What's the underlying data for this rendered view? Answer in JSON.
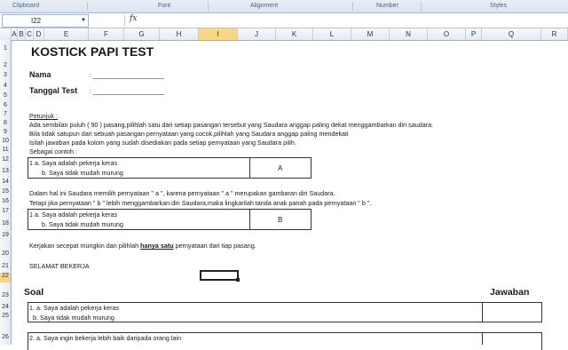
{
  "ribbon": {
    "groups": [
      "Clipboard",
      "Font",
      "Alignment",
      "Number",
      "Styles"
    ]
  },
  "formula_bar": {
    "name_box": "I22",
    "fx_label": "fx",
    "formula": ""
  },
  "columns": [
    "A",
    "B",
    "C",
    "D",
    "E",
    "F",
    "G",
    "H",
    "I",
    "J",
    "K",
    "L",
    "M",
    "N",
    "O",
    "P",
    "Q",
    "R"
  ],
  "selected_column": "I",
  "rows": [
    "1",
    "2",
    "3",
    "4",
    "5",
    "6",
    "7",
    "8",
    "9",
    "10",
    "11",
    "12",
    "13",
    "14",
    "15",
    "16",
    "17",
    "18",
    "19",
    "20",
    "21",
    "22",
    "23",
    "24",
    "25",
    "26"
  ],
  "selected_row": "22",
  "sheet": {
    "title": "KOSTICK PAPI TEST",
    "nama_label": "Nama",
    "nama_field": ": ____________________",
    "tanggal_label": "Tanggal Test",
    "tanggal_field": ": ____________________",
    "petunjuk": "Petunjuk :",
    "line7": "Ada sembilan puluh ( 90 ) pasang,pilihlah satu dari setiap pasangan tersebut yang Saudara anggap paling dekat menggambarkan diri saudara.",
    "line8": "Bila tidak satupun dari sebuah pasangan pernyataan yang cocok,pilihlah yang Saudara anggap paling mendekati",
    "line9": "Isilah jawaban pada kolom yang sudah disediakan  pada setiap pernyataan yang Saudara pilih.",
    "contoh": "Sebagai contoh :",
    "ex1_a": "1   a. Saya adalah pekerja keras",
    "ex1_b": "b. Saya tidak mudah murung",
    "ex1_answer": "A",
    "line14": "Dalam hal ini Saudara memilih pernyataan \" a \", karena pernyataan \" a \" merupakan gambaran diri Saudara.",
    "line15": "Tetapi jika pernyataan \" b \" lebih menggambarkan diri Saudara,maka lingkarilah tanda anak panah pada pernyataan \" b \".",
    "ex2_a": "1   a. Saya adalah pekerja keras",
    "ex2_b": "b. Saya tidak mudah murung",
    "ex2_answer": "B",
    "line19_pre": "Kerjakan secepat mungkin dan pilihlah ",
    "line19_em": "hanya satu",
    "line19_post": " pernyataan dari tiap pasang.",
    "salam": "SELAMAT BEKERJA",
    "soal_header": "Soal",
    "jawaban_header": "Jawaban",
    "q1_a": "1. a. Saya adalah pekerja keras",
    "q1_b": "b. Saya tidak mudah murung",
    "q2_a": "2. a. Saya ingin bekerja lebih baik daripada orang lain"
  }
}
